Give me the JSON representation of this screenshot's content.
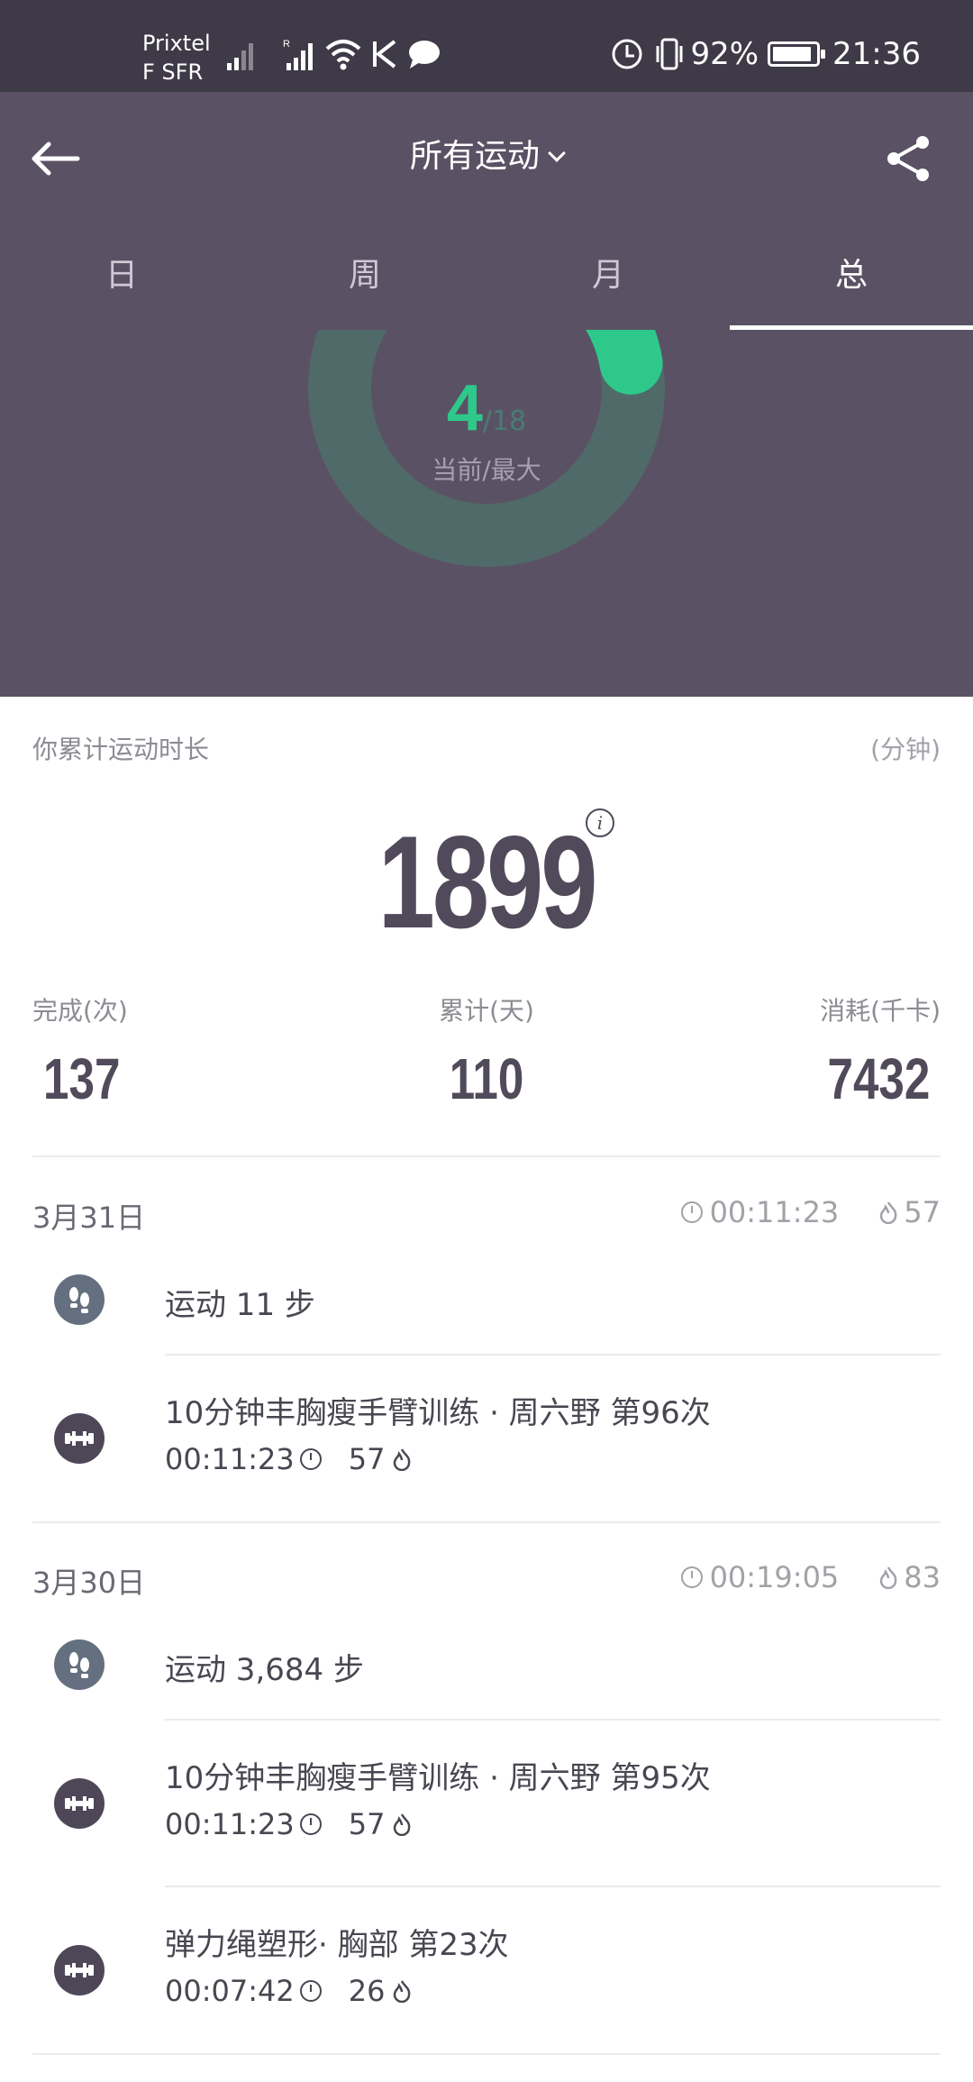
{
  "status_bar": {
    "carrier_line1": "Prixtel",
    "carrier_line2": "F SFR",
    "battery": "92%",
    "battery_level": 0.92,
    "time": "21:36"
  },
  "header": {
    "title": "所有运动",
    "tabs": [
      {
        "label": "日"
      },
      {
        "label": "周"
      },
      {
        "label": "月"
      },
      {
        "label": "总"
      }
    ],
    "active_tab": 3
  },
  "ring": {
    "current": "4",
    "max": "/18",
    "label": "当前/最大",
    "fraction": 0.2222,
    "colors": {
      "track": "#4f6a68",
      "progress": "#2ec98a"
    }
  },
  "summary": {
    "label": "你累计运动时长",
    "unit": "(分钟)",
    "total": "1899",
    "stats": [
      {
        "label": "完成(次)",
        "value": "137"
      },
      {
        "label": "累计(天)",
        "value": "110"
      },
      {
        "label": "消耗(千卡)",
        "value": "7432"
      }
    ]
  },
  "days": [
    {
      "date": "3月31日",
      "duration": "00:11:23",
      "calories": "57",
      "items": [
        {
          "type": "steps",
          "icon": "footprints-icon",
          "title": "运动 11 步"
        },
        {
          "type": "training",
          "icon": "dumbbell-icon",
          "title": "10分钟丰胸瘦手臂训练 · 周六野 第96次",
          "duration": "00:11:23",
          "calories": "57"
        }
      ]
    },
    {
      "date": "3月30日",
      "duration": "00:19:05",
      "calories": "83",
      "items": [
        {
          "type": "steps",
          "icon": "footprints-icon",
          "title": "运动 3,684 步"
        },
        {
          "type": "training",
          "icon": "dumbbell-icon",
          "title": "10分钟丰胸瘦手臂训练 · 周六野 第95次",
          "duration": "00:11:23",
          "calories": "57"
        },
        {
          "type": "training",
          "icon": "dumbbell-icon",
          "title": "弹力绳塑形· 胸部 第23次",
          "duration": "00:07:42",
          "calories": "26"
        }
      ]
    }
  ]
}
